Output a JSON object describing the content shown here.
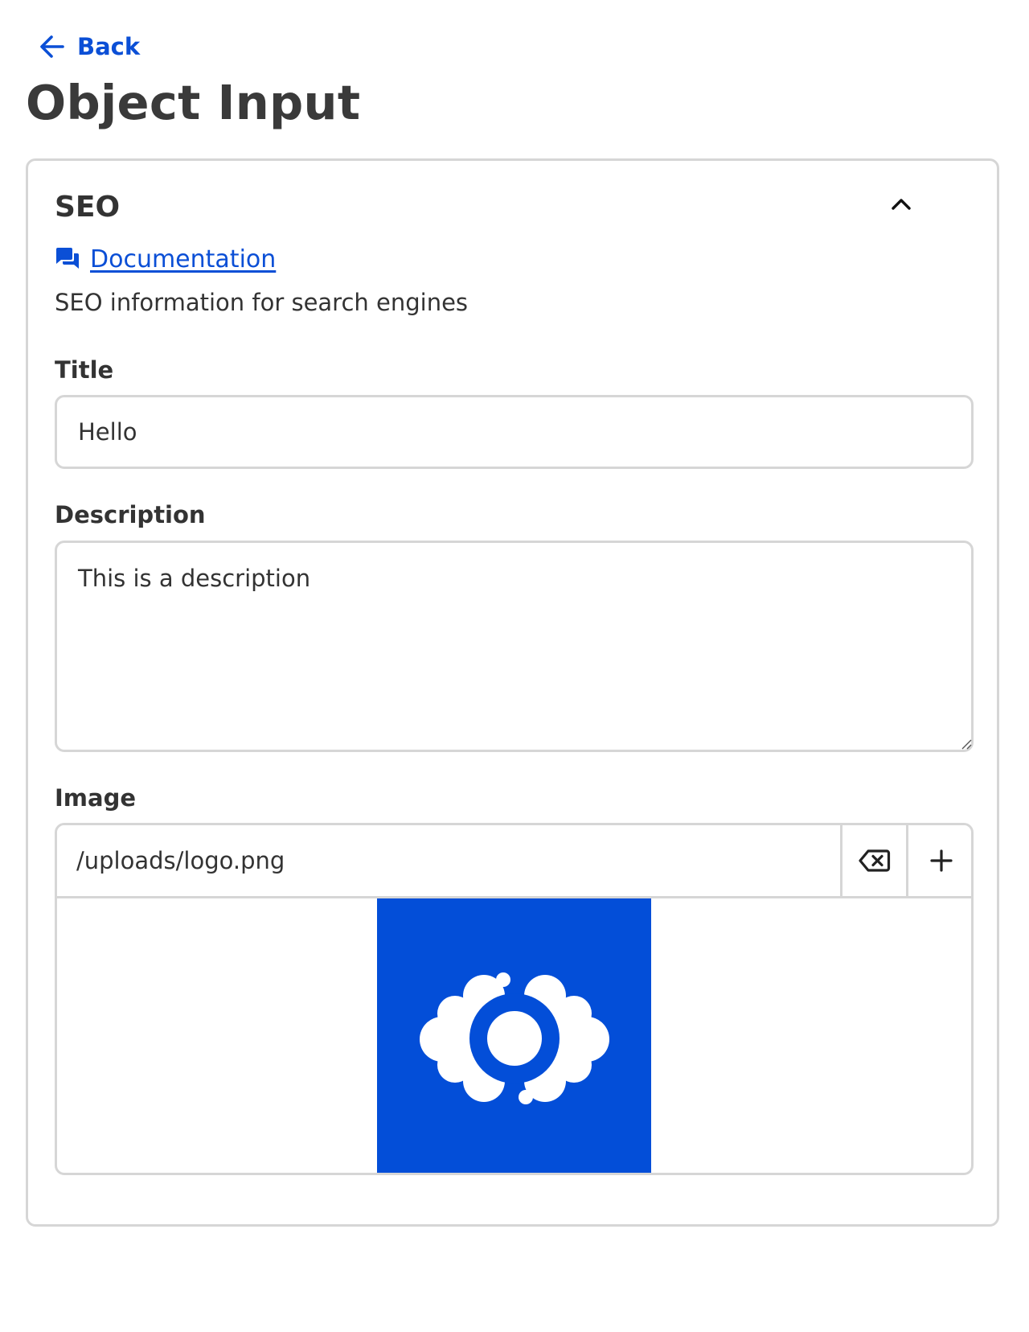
{
  "nav": {
    "back_label": "Back",
    "back_icon": "arrow-left-icon"
  },
  "page": {
    "title": "Object Input"
  },
  "section": {
    "title": "SEO",
    "collapse_icon": "chevron-up-icon",
    "documentation_label": "Documentation",
    "documentation_icon": "chat-bubbles-icon",
    "description": "SEO information for search engines"
  },
  "fields": {
    "title": {
      "label": "Title",
      "value": "Hello"
    },
    "description": {
      "label": "Description",
      "value": "This is a description"
    },
    "image": {
      "label": "Image",
      "value": "/uploads/logo.png",
      "clear_icon": "backspace-clear-icon",
      "add_icon": "plus-icon"
    }
  },
  "colors": {
    "accent": "#0b4fd6",
    "logo_background": "#034ed8",
    "text": "#333333",
    "border": "#d6d6d6"
  }
}
